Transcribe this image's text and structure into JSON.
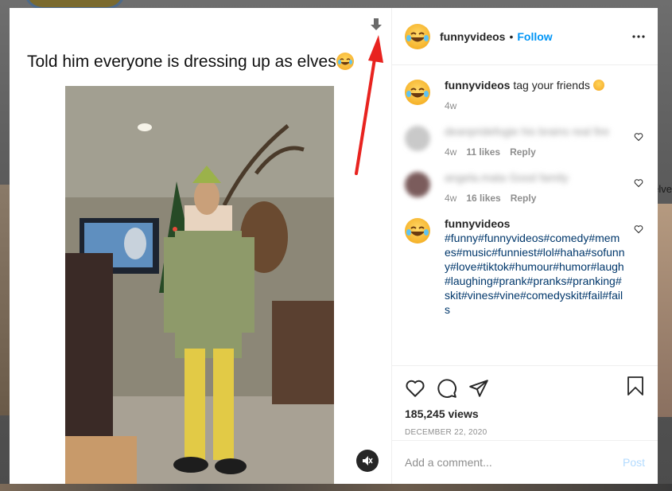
{
  "post": {
    "caption_overlay": "Told him everyone is dressing up as elves"
  },
  "header": {
    "username": "funnyvideos",
    "separator": "•",
    "follow_label": "Follow"
  },
  "comments": [
    {
      "username": "funnyvideos",
      "text": "tag your friends",
      "time": "4w"
    },
    {
      "username": "",
      "text": "deanpridefogie his brains real fire",
      "time": "4w",
      "likes": "11 likes",
      "reply": "Reply"
    },
    {
      "username": "",
      "text": "angela.mata Good family",
      "time": "4w",
      "likes": "16 likes",
      "reply": "Reply"
    },
    {
      "username": "funnyvideos",
      "text": "#funny#funnyvideos#comedy#memes#music#funniest#lol#haha#sofunny#love#tiktok#humour#humor#laugh#laughing#prank#pranks#pranking#skit#vines#vine#comedyskit#fail#fails"
    }
  ],
  "stats": {
    "views": "185,245 views",
    "date": "DECEMBER 22, 2020"
  },
  "composer": {
    "placeholder": "Add a comment...",
    "post_label": "Post"
  },
  "background": {
    "right_edge_text": "elve"
  },
  "colors": {
    "accent": "#0095f6",
    "hashtag": "#00376b",
    "annotation": "#e8231f",
    "muted_text": "#8e8e8e"
  },
  "icons": [
    "download-icon",
    "more-icon",
    "heart-icon",
    "comment-icon",
    "share-icon",
    "bookmark-icon",
    "mute-icon"
  ]
}
